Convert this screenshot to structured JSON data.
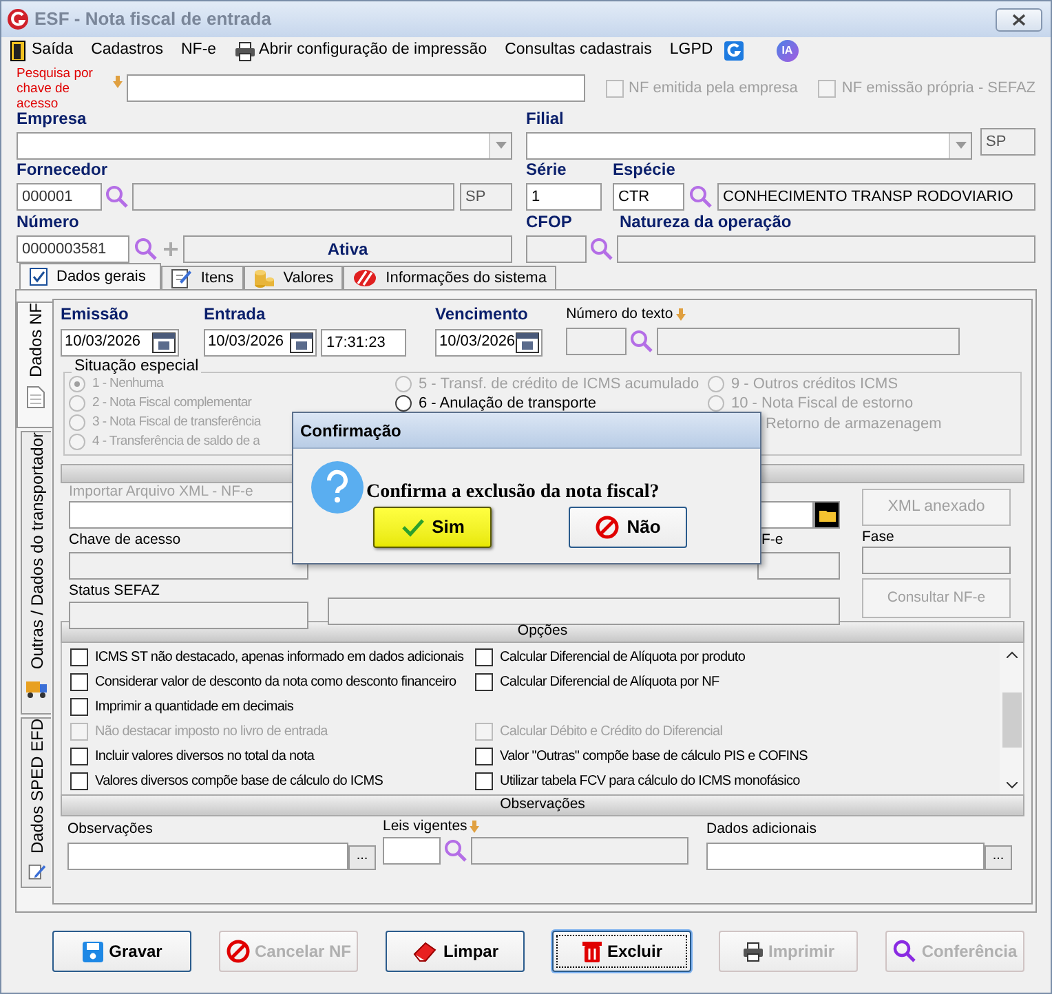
{
  "window": {
    "title": "ESF - Nota fiscal de entrada"
  },
  "menu": [
    {
      "label": "Saída",
      "kind": "exit"
    },
    {
      "label": "Cadastros"
    },
    {
      "label": "NF-e"
    },
    {
      "label": "Abrir configuração de impressão",
      "kind": "printer"
    },
    {
      "label": "Consultas cadastrais"
    },
    {
      "label": "LGPD"
    }
  ],
  "ia_badge": "IA",
  "search": {
    "label": "Pesquisa por chave de acesso"
  },
  "flags": [
    {
      "label": "NF emitida pela empresa",
      "checked": false,
      "disabled": true
    },
    {
      "label": "NF emissão própria - SEFAZ",
      "checked": false,
      "disabled": true
    }
  ],
  "empresa": {
    "label": "Empresa"
  },
  "filial": {
    "label": "Filial",
    "uf": "SP"
  },
  "fornecedor": {
    "label": "Fornecedor",
    "code": "000001",
    "uf": "SP"
  },
  "serie": {
    "label": "Série",
    "value": "1"
  },
  "especie": {
    "label": "Espécie",
    "value": "CTR",
    "description": "CONHECIMENTO TRANSP RODOVIARIO"
  },
  "numero": {
    "label": "Número",
    "value": "0000003581",
    "status": "Ativa"
  },
  "cfop": {
    "label": "CFOP"
  },
  "natureza": {
    "label": "Natureza da operação"
  },
  "tabs": [
    {
      "label": "Dados gerais",
      "kind": "check",
      "selected": true
    },
    {
      "label": "Itens",
      "kind": "note",
      "selected": false
    },
    {
      "label": "Valores",
      "kind": "coins",
      "selected": false
    },
    {
      "label": "Informações do sistema",
      "kind": "stripes",
      "selected": false
    }
  ],
  "side_tabs": [
    {
      "label": "Dados NF",
      "kind": "doc",
      "selected": true
    },
    {
      "label": "Outras / Dados do transportador",
      "kind": "truck",
      "selected": false
    },
    {
      "label": "Dados SPED EFD",
      "kind": "pencil",
      "selected": false
    }
  ],
  "emissao": {
    "label": "Emissão",
    "value": "10/03/2026"
  },
  "entrada": {
    "label": "Entrada",
    "value": "10/03/2026",
    "time": "17:31:23"
  },
  "vencimento": {
    "label": "Vencimento",
    "value": "10/03/2026"
  },
  "numero_texto": {
    "label": "Número do texto"
  },
  "situacao": {
    "title": "Situação especial",
    "columns": [
      [
        {
          "label": "1 - Nenhuma",
          "selected": true,
          "disabled": true
        },
        {
          "label": "2 - Nota Fiscal complementar",
          "selected": false,
          "disabled": true
        },
        {
          "label": "3 - Nota Fiscal de transferência",
          "selected": false,
          "disabled": true
        },
        {
          "label": "4 - Transferência de saldo de a",
          "selected": false,
          "disabled": true
        }
      ],
      [
        {
          "label": "5 - Transf. de crédito de ICMS acumulado",
          "selected": false,
          "disabled": true
        },
        {
          "label": "6 - Anulação de transporte",
          "selected": false,
          "disabled": false
        }
      ],
      [
        {
          "label": "9 - Outros créditos ICMS",
          "selected": false,
          "disabled": true
        },
        {
          "label": "10 - Nota Fiscal de estorno",
          "selected": false,
          "disabled": true
        }
      ]
    ],
    "trailing_text": "Retorno de armazenagem"
  },
  "xml": {
    "import_label": "Importar Arquivo XML - NF-e",
    "attached_button": "XML anexado",
    "chave_label": "Chave de acesso",
    "nfe_label": "F-e",
    "fase_label": "Fase",
    "status_label": "Status SEFAZ",
    "consult_button": "Consultar NF-e"
  },
  "options": {
    "title": "Opções",
    "rows": [
      {
        "left": {
          "label": "ICMS ST  não destacado, apenas informado em dados adicionais",
          "checked": false,
          "disabled": false
        },
        "right": {
          "label": "Calcular Diferencial de Alíquota por produto",
          "checked": false,
          "disabled": false
        }
      },
      {
        "left": {
          "label": "Considerar valor de desconto da nota como desconto financeiro",
          "checked": false,
          "disabled": false
        },
        "right": {
          "label": "Calcular Diferencial de Alíquota por NF",
          "checked": false,
          "disabled": false
        }
      },
      {
        "left": {
          "label": "Imprimir a quantidade em decimais",
          "checked": false,
          "disabled": false
        }
      },
      {
        "left": {
          "label": "Não destacar imposto no livro de entrada",
          "checked": false,
          "disabled": true
        },
        "right": {
          "label": "Calcular Débito e Crédito do Diferencial",
          "checked": false,
          "disabled": true
        }
      },
      {
        "left": {
          "label": "Incluir valores diversos no total da nota",
          "checked": false,
          "disabled": false
        },
        "right": {
          "label": "Valor \"Outras\" compõe base de cálculo PIS e COFINS",
          "checked": false,
          "disabled": false
        }
      },
      {
        "left": {
          "label": "Valores diversos compõe base de cálculo do ICMS",
          "checked": false,
          "disabled": false
        },
        "right": {
          "label": "Utilizar tabela FCV para cálculo do ICMS monofásico",
          "checked": false,
          "disabled": false
        }
      }
    ]
  },
  "observacoes": {
    "title": "Observações",
    "obs_label": "Observações",
    "leis_label": "Leis vigentes",
    "dados_label": "Dados adicionais",
    "more": "..."
  },
  "buttons": [
    {
      "label": "Gravar",
      "kind": "save",
      "disabled": false,
      "focused": false
    },
    {
      "label": "Cancelar NF",
      "kind": "cancel",
      "disabled": true,
      "focused": false
    },
    {
      "label": "Limpar",
      "kind": "eraser",
      "disabled": false,
      "focused": false
    },
    {
      "label": "Excluir",
      "kind": "trash",
      "disabled": false,
      "focused": true
    },
    {
      "label": "Imprimir",
      "kind": "printer",
      "disabled": true,
      "focused": false
    },
    {
      "label": "Conferência",
      "kind": "search",
      "disabled": true,
      "focused": false
    }
  ],
  "dialog": {
    "title": "Confirmação",
    "message": "Confirma a exclusão da nota fiscal?",
    "buttons": [
      {
        "label": "Sim",
        "kind": "ok",
        "selected": true
      },
      {
        "label": "Não",
        "kind": "no",
        "selected": false
      }
    ]
  }
}
